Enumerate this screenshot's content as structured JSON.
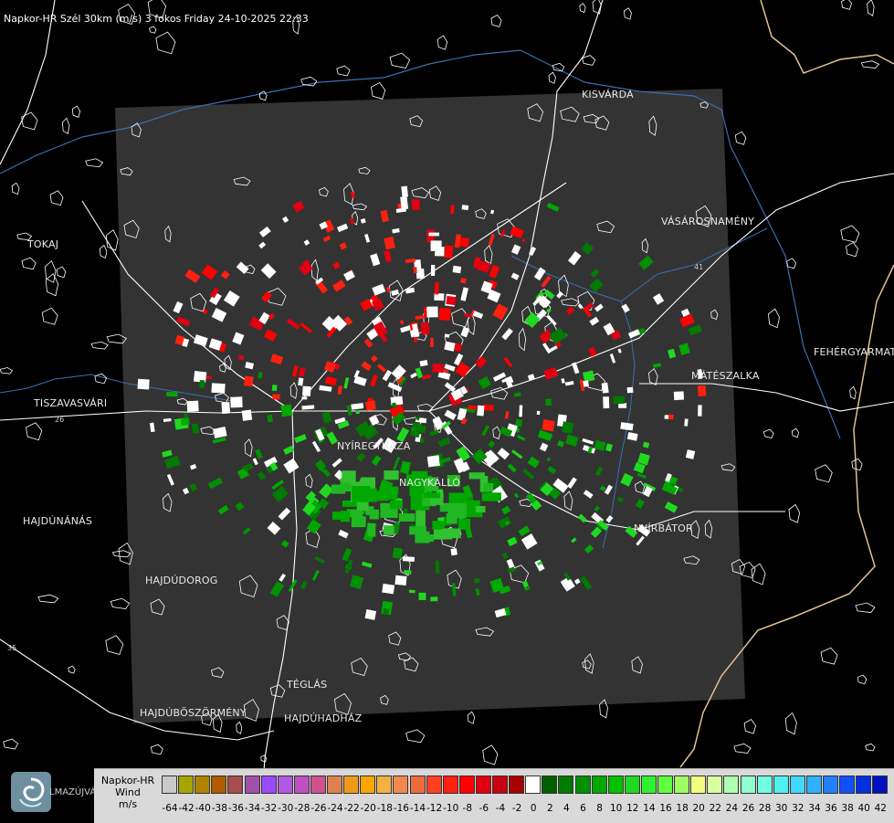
{
  "title": "Napkor-HR Szél 30km (m/s) 3 fokos Friday 24-10-2025 22:33",
  "map": {
    "cities": [
      {
        "name": "KISVÁRDA"
      },
      {
        "name": "VÁSÁROSNAMÉNY"
      },
      {
        "name": "TOKAJ"
      },
      {
        "name": "FEHÉRGYARMAT"
      },
      {
        "name": "MÁTÉSZALKA"
      },
      {
        "name": "TISZAVASVÁRI"
      },
      {
        "name": "NYÍREGYHÁZA"
      },
      {
        "name": "NAGYKÁLLÓ"
      },
      {
        "name": "NYÍRBÁTOR"
      },
      {
        "name": "HAJDÚNÁNÁS"
      },
      {
        "name": "HAJDÚDOROG"
      },
      {
        "name": "TÉGLÁS"
      },
      {
        "name": "HAJDÚBÖSZÖRMÉNY"
      },
      {
        "name": "HAJDÚHADHÁZ"
      }
    ],
    "road_labels": [
      "26",
      "41",
      "35"
    ]
  },
  "legend": {
    "line1": "Napkor-HR",
    "line2": "Wind",
    "line3": "m/s",
    "logo_text": "LMAZÚJVÁR",
    "swatches": [
      {
        "value": "-64",
        "color": "#c9c9c9"
      },
      {
        "value": "-42",
        "color": "#a6a600"
      },
      {
        "value": "-40",
        "color": "#b08400"
      },
      {
        "value": "-38",
        "color": "#b05a00"
      },
      {
        "value": "-36",
        "color": "#a84e4e"
      },
      {
        "value": "-34",
        "color": "#a050a8"
      },
      {
        "value": "-32",
        "color": "#9a4aff"
      },
      {
        "value": "-30",
        "color": "#b05ae0"
      },
      {
        "value": "-28",
        "color": "#c050c0"
      },
      {
        "value": "-26",
        "color": "#d05090"
      },
      {
        "value": "-24",
        "color": "#e08050"
      },
      {
        "value": "-22",
        "color": "#f09a1a"
      },
      {
        "value": "-20",
        "color": "#ffa500"
      },
      {
        "value": "-18",
        "color": "#f5b040"
      },
      {
        "value": "-16",
        "color": "#f08850"
      },
      {
        "value": "-14",
        "color": "#f06a3a"
      },
      {
        "value": "-12",
        "color": "#ff4020"
      },
      {
        "value": "-10",
        "color": "#ff2010"
      },
      {
        "value": "-8",
        "color": "#ff0000"
      },
      {
        "value": "-6",
        "color": "#e00010"
      },
      {
        "value": "-4",
        "color": "#c80010"
      },
      {
        "value": "-2",
        "color": "#a80000"
      },
      {
        "value": "0",
        "color": "#ffffff"
      },
      {
        "value": "2",
        "color": "#006000"
      },
      {
        "value": "4",
        "color": "#007a00"
      },
      {
        "value": "6",
        "color": "#009000"
      },
      {
        "value": "8",
        "color": "#00a800"
      },
      {
        "value": "10",
        "color": "#00c000"
      },
      {
        "value": "12",
        "color": "#20d820"
      },
      {
        "value": "14",
        "color": "#30f030"
      },
      {
        "value": "16",
        "color": "#60ff40"
      },
      {
        "value": "18",
        "color": "#a0ff60"
      },
      {
        "value": "20",
        "color": "#f0ff80"
      },
      {
        "value": "22",
        "color": "#d8ffa0"
      },
      {
        "value": "24",
        "color": "#b0ffb0"
      },
      {
        "value": "26",
        "color": "#90ffd0"
      },
      {
        "value": "28",
        "color": "#70ffe0"
      },
      {
        "value": "30",
        "color": "#50f0f0"
      },
      {
        "value": "32",
        "color": "#40d8ff"
      },
      {
        "value": "34",
        "color": "#30b0ff"
      },
      {
        "value": "36",
        "color": "#2080ff"
      },
      {
        "value": "38",
        "color": "#1050ff"
      },
      {
        "value": "40",
        "color": "#0030e0"
      },
      {
        "value": "42",
        "color": "#0010c0"
      }
    ]
  }
}
